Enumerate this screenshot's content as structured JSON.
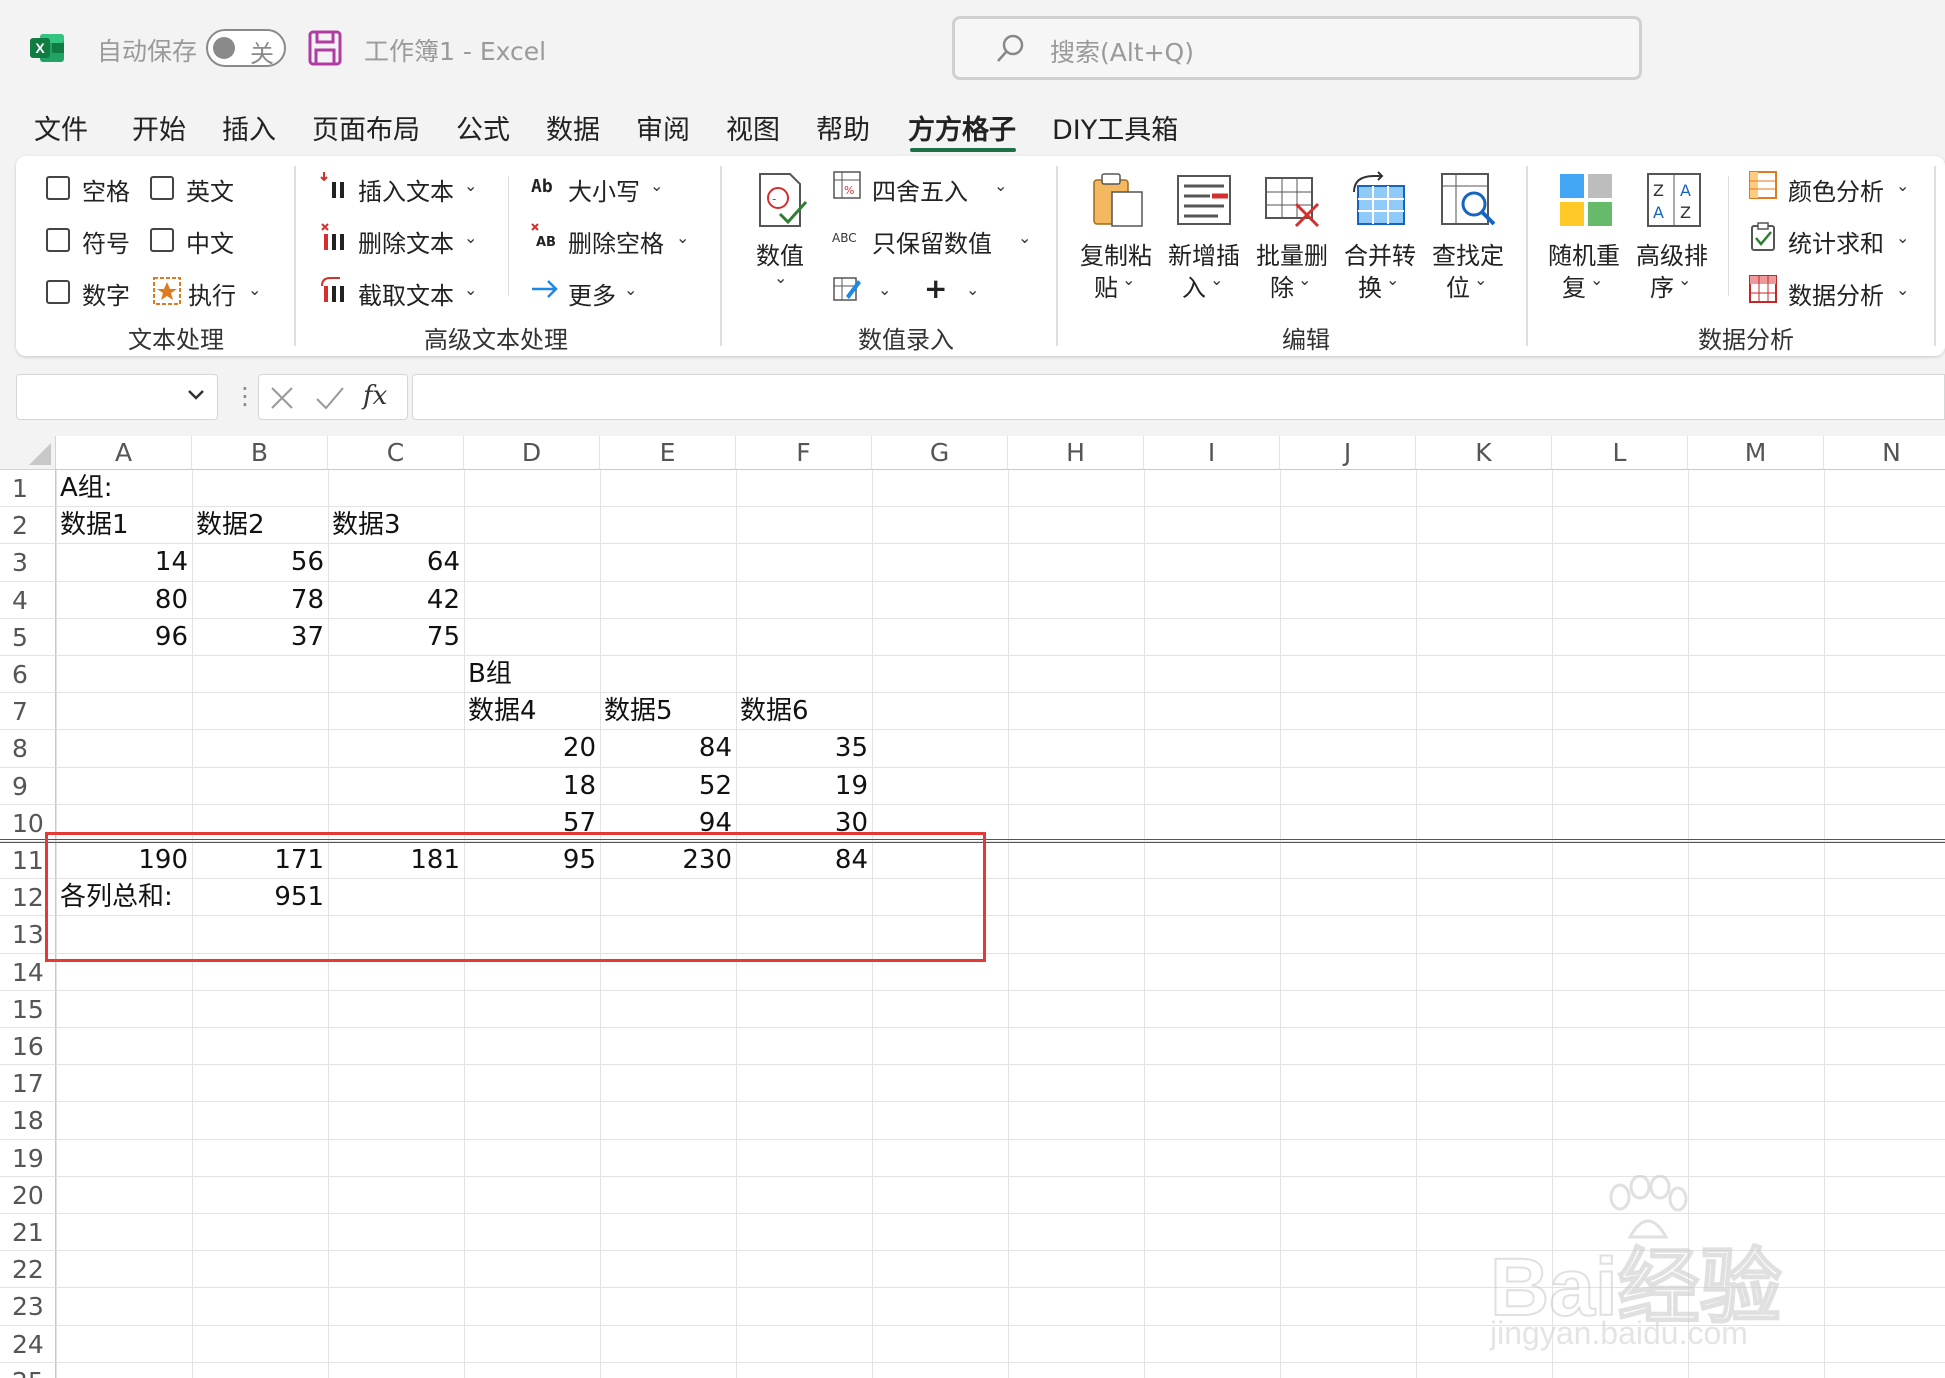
{
  "titlebar": {
    "autosave_label": "自动保存",
    "autosave_state": "关",
    "doc_title": "工作簿1  -  Excel",
    "search_placeholder": "搜索(Alt+Q)"
  },
  "menu": {
    "tabs": [
      "文件",
      "开始",
      "插入",
      "页面布局",
      "公式",
      "数据",
      "审阅",
      "视图",
      "帮助",
      "方方格子",
      "DIY工具箱"
    ],
    "active_tab": "方方格子"
  },
  "ribbon": {
    "text_processing": {
      "label": "文本处理",
      "checkboxes": [
        "空格",
        "英文",
        "符号",
        "中文",
        "数字"
      ],
      "execute": "执行"
    },
    "advanced_text": {
      "label": "高级文本处理",
      "insert_text": "插入文本",
      "delete_text": "删除文本",
      "extract_text": "截取文本",
      "case": "大小写",
      "delete_space": "删除空格",
      "more": "更多"
    },
    "value_entry": {
      "label": "数值录入",
      "value_button": "数值",
      "round": "四舍五入",
      "keep_value": "只保留数值"
    },
    "edit": {
      "label": "编辑",
      "copy_paste": [
        "复制粘",
        "贴"
      ],
      "new_insert": [
        "新增插",
        "入"
      ],
      "batch_delete": [
        "批量删",
        "除"
      ],
      "merge_convert": [
        "合并转",
        "换"
      ],
      "find_locate": [
        "查找定",
        "位"
      ]
    },
    "data_analysis": {
      "label": "数据分析",
      "random_repeat": [
        "随机重",
        "复"
      ],
      "advanced_sort": [
        "高级排",
        "序"
      ],
      "color_analysis": "颜色分析",
      "stat_sum": "统计求和",
      "data_analysis_btn": "数据分析"
    }
  },
  "formula_bar": {
    "name_box": "",
    "fx_label": "fx",
    "formula": ""
  },
  "sheet": {
    "columns": [
      "A",
      "B",
      "C",
      "D",
      "E",
      "F",
      "G",
      "H",
      "I",
      "J",
      "K",
      "L",
      "M",
      "N"
    ],
    "rows": [
      "1",
      "2",
      "3",
      "4",
      "5",
      "6",
      "7",
      "8",
      "9",
      "10",
      "11",
      "12",
      "13",
      "14",
      "15",
      "16",
      "17",
      "18",
      "19",
      "20",
      "21",
      "22",
      "23",
      "24",
      "25"
    ],
    "cells": {
      "A1": "A组:",
      "A2": "数据1",
      "B2": "数据2",
      "C2": "数据3",
      "A3": "14",
      "B3": "56",
      "C3": "64",
      "A4": "80",
      "B4": "78",
      "C4": "42",
      "A5": "96",
      "B5": "37",
      "C5": "75",
      "D6": "B组",
      "D7": "数据4",
      "E7": "数据5",
      "F7": "数据6",
      "D8": "20",
      "E8": "84",
      "F8": "35",
      "D9": "18",
      "E9": "52",
      "F9": "19",
      "D10": "57",
      "E10": "94",
      "F10": "30",
      "A11": "190",
      "B11": "171",
      "C11": "181",
      "D11": "95",
      "E11": "230",
      "F11": "84",
      "A12": "各列总和:",
      "B12": "951"
    }
  },
  "colors": {
    "excel_green": "#1e7145",
    "highlight_red": "#e53935",
    "chrome_bg": "#f3f3f3"
  },
  "watermark": {
    "brand": "Bai经验",
    "url": "jingyan.baidu.com"
  }
}
